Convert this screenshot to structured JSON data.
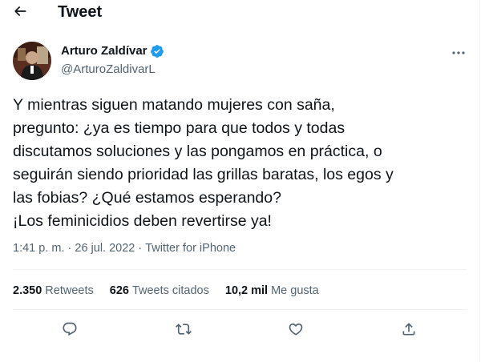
{
  "header": {
    "title": "Tweet",
    "back_icon": "arrow-left-icon"
  },
  "author": {
    "name": "Arturo Zaldívar",
    "handle": "@ArturoZaldivarL",
    "verified_color": "#1d9bf0"
  },
  "tweet": {
    "text": "Y mientras siguen matando mujeres con saña,\npregunto: ¿ya es tiempo para que todos y todas\ndiscutamos soluciones y las pongamos en práctica, o\nseguirán siendo prioridad las grillas baratas, los egos y\nlas fobias? ¿Qué estamos esperando?\n¡Los feminicidios deben revertirse ya!",
    "time": "1:41 p. m.",
    "separator": " · ",
    "date": "26 jul. 2022",
    "source": "Twitter for iPhone"
  },
  "stats": {
    "retweets_count": "2.350",
    "retweets_label": "Retweets",
    "quotes_count": "626",
    "quotes_label": "Tweets citados",
    "likes_count": "10,2 mil",
    "likes_label": "Me gusta"
  },
  "actions": [
    "reply-icon",
    "retweet-icon",
    "like-icon",
    "share-icon"
  ],
  "colors": {
    "text": "#0f1419",
    "secondary": "#536471",
    "divider": "#eff3f4",
    "accent": "#1d9bf0"
  }
}
